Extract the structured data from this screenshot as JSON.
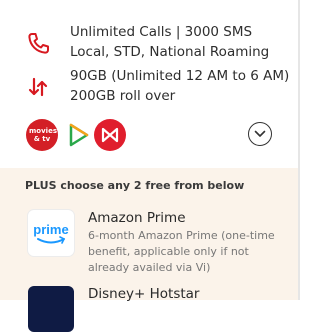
{
  "colors": {
    "accent_red": "#d71920",
    "plus_bg": "#fbf3ea",
    "prime_blue": "#1a98ff",
    "hotstar_bg": "#0f1b44"
  },
  "features": [
    {
      "icon": "phone-icon",
      "lines": [
        "Unlimited Calls | 3000 SMS",
        "Local, STD, National Roaming"
      ]
    },
    {
      "icon": "data-arrows-icon",
      "lines": [
        "90GB (Unlimited 12 AM to 6 AM)",
        "200GB roll over"
      ]
    }
  ],
  "apps": {
    "movies_logo_text": "movies & tv",
    "icons": [
      "movies-tv-logo-icon",
      "play-triangle-logo-icon",
      "red-bow-logo-icon"
    ],
    "expand_icon": "chevron-down-icon"
  },
  "plus": {
    "heading": "PLUS choose any 2 free from below",
    "offers": [
      {
        "title": "Amazon Prime",
        "logo_text": "prime",
        "desc": [
          "6-month Amazon Prime (one-time",
          "benefit, applicable only if not",
          "already availed via Vi)"
        ]
      },
      {
        "title": "Disney+ Hotstar",
        "logo_text": "",
        "desc": []
      }
    ]
  }
}
